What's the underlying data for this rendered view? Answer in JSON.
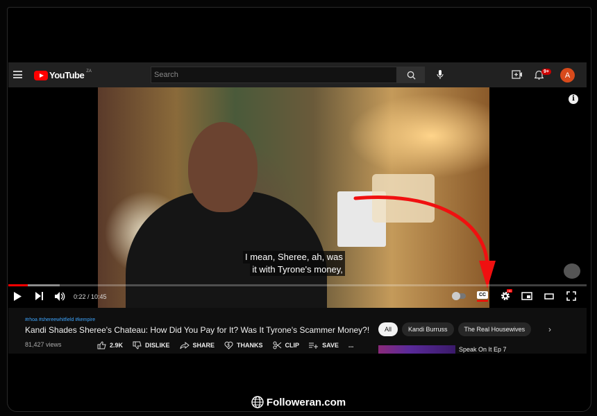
{
  "header": {
    "logo_text": "YouTube",
    "region": "ZA",
    "search_placeholder": "Search",
    "notifications_badge": "9+",
    "avatar_letter": "A",
    "colors": {
      "bar": "#212121",
      "brand": "#ff0000",
      "avatar": "#d84a1b"
    }
  },
  "player": {
    "subtitle_lines": [
      "I mean, Sheree, ah, was",
      "it with Tyrone's money,"
    ],
    "time": "0:22 / 10:45",
    "progress_fraction": 0.034,
    "captions_on": true,
    "settings_badge": "HD"
  },
  "video": {
    "hashtags": "#rhoa #shereewhitfield #kempire",
    "title": "Kandi Shades Sheree's Chateau: How Did You Pay for It? Was It Tyrone's Scammer Money?!",
    "views": "81,427 views",
    "actions": {
      "likes": "2.9K",
      "dislike": "DISLIKE",
      "share": "SHARE",
      "thanks": "THANKS",
      "clip": "CLIP",
      "save": "SAVE",
      "more": "..."
    }
  },
  "sidebar": {
    "chips": [
      "All",
      "Kandi Burruss",
      "The Real Housewives"
    ],
    "related_title": "Speak On It Ep 7"
  },
  "footer": {
    "watermark": "Followeran.com"
  }
}
